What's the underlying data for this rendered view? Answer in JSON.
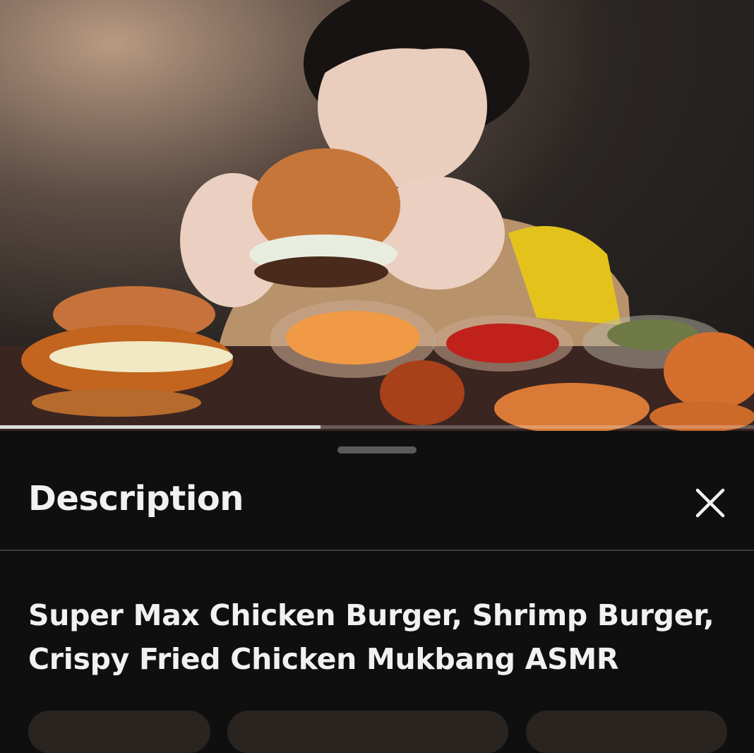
{
  "video": {
    "progress_fraction": 0.425
  },
  "panel": {
    "title": "Description",
    "close_icon": "close-icon"
  },
  "description": {
    "video_title": "Super Max Chicken Burger, Shrimp Burger, Crispy Fried Chicken Mukbang ASMR"
  },
  "colors": {
    "background": "#0f0f0f",
    "text": "#f1f1f1",
    "divider": "#3a3a3a",
    "handle": "#5a5a5a",
    "progress": "#dcdcdc",
    "chip": "#2a2420"
  }
}
